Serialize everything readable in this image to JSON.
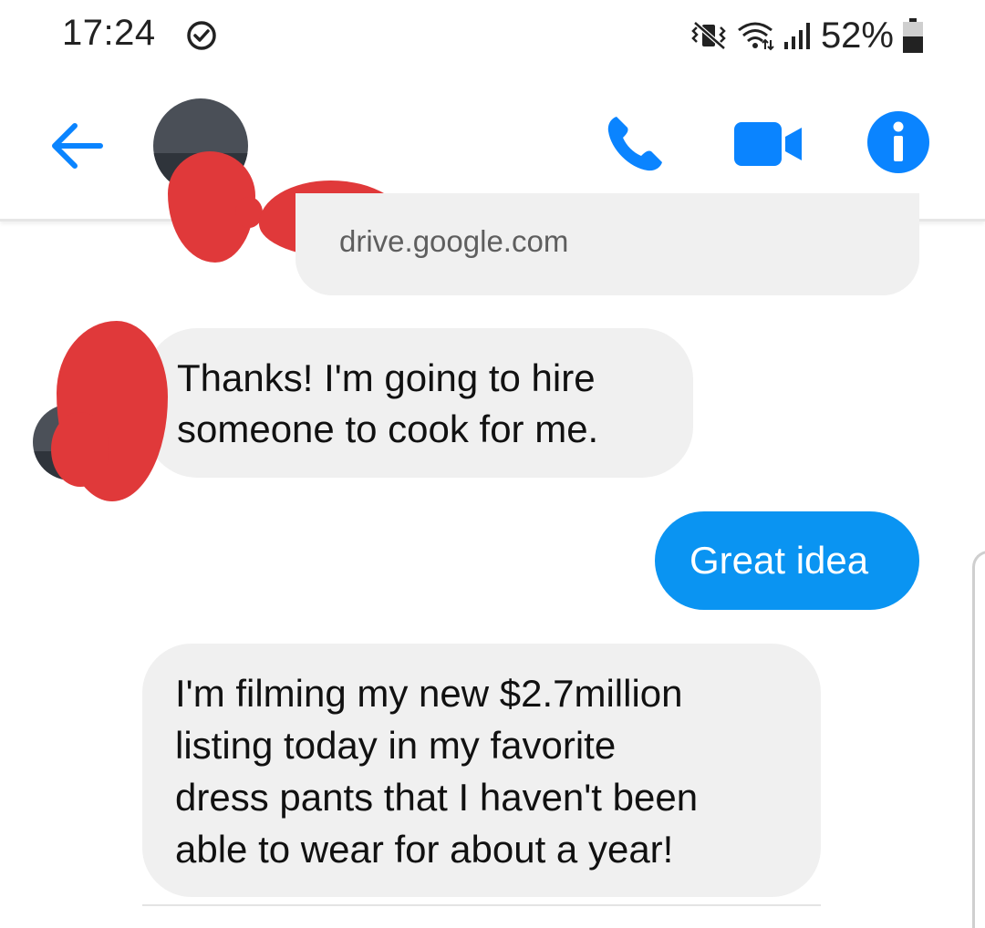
{
  "status_bar": {
    "time": "17:24",
    "battery_percent": "52%",
    "sync_icon": "sync-check-icon",
    "mute_icon": "vibrate-mute-icon",
    "wifi_icon": "wifi-icon",
    "signal_icon": "signal-bars-icon",
    "battery_icon": "battery-icon",
    "battery_level": 0.52
  },
  "header": {
    "back_icon": "arrow-left-icon",
    "call_icon": "phone-icon",
    "video_icon": "video-camera-icon",
    "info_icon": "info-icon",
    "accent_color": "#0a84ff"
  },
  "conversation": {
    "link_preview_domain": "drive.google.com",
    "messages": [
      {
        "direction": "incoming",
        "text": "Thanks! I'm going to hire\nsomeone to cook for me."
      },
      {
        "direction": "outgoing",
        "text": "Great idea"
      },
      {
        "direction": "incoming",
        "text": "I'm filming my new $2.7million\nlisting today in my favorite\ndress pants that I haven't been\nable to wear for about a year!"
      }
    ],
    "incoming_bubble_color": "#f0f0f0",
    "outgoing_bubble_color": "#0a94f2"
  }
}
